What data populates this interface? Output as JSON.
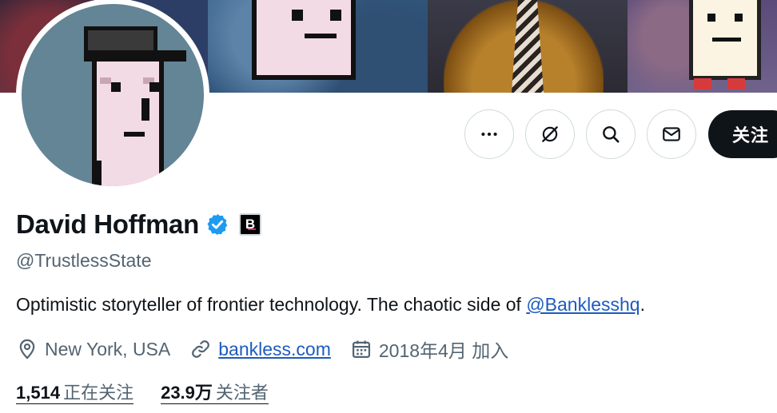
{
  "profile": {
    "display_name": "David Hoffman",
    "affiliate_badge": "B",
    "handle": "@TrustlessState",
    "bio_text": "Optimistic storyteller of frontier technology. The chaotic side of ",
    "bio_mention": "@Banklesshq",
    "bio_end": ".",
    "location": "New York, USA",
    "website": "bankless.com",
    "joined": "2018年4月 加入"
  },
  "stats": {
    "following_count": "1,514",
    "following_label": "正在关注",
    "followers_count": "23.9万",
    "followers_label": "关注者"
  },
  "actions": {
    "follow_label": "关注"
  },
  "icons": {
    "more": "more-icon",
    "grok": "grok-icon",
    "search": "search-icon",
    "message": "mail-icon",
    "verified": "verified-badge-icon",
    "location": "location-icon",
    "link": "link-icon",
    "calendar": "calendar-icon"
  },
  "colors": {
    "verified_blue": "#1d9bf0",
    "link_blue": "#1d5bbf",
    "secondary_text": "#536471",
    "primary_text": "#0f1419",
    "follow_bg": "#0f1419"
  }
}
